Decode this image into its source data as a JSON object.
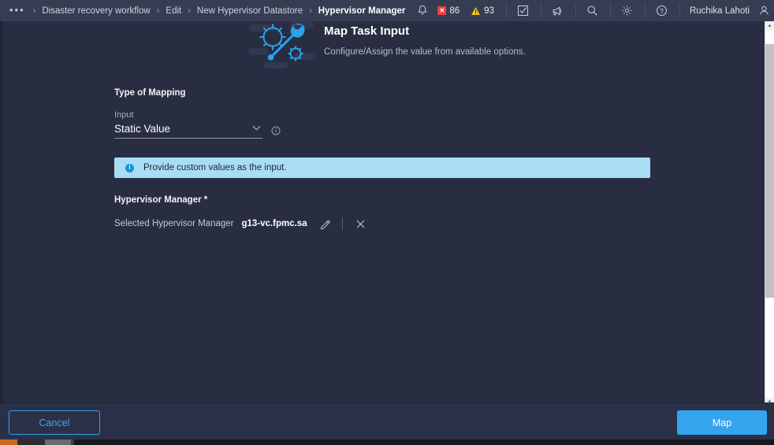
{
  "topbar": {
    "breadcrumb_overflow": "•••",
    "breadcrumb_separator": "›",
    "breadcrumb": [
      {
        "label": "Disaster recovery workflow",
        "current": false
      },
      {
        "label": "Edit",
        "current": false
      },
      {
        "label": "New Hypervisor Datastore",
        "current": false
      },
      {
        "label": "Hypervisor Manager",
        "current": true
      }
    ],
    "notifications": {
      "bell_icon": "bell-icon",
      "error_badge_glyph": "✕",
      "error_count": "86",
      "warning_count": "93"
    },
    "icons": [
      {
        "name": "tasks-icon",
        "label": "Tasks"
      },
      {
        "name": "announcements-icon",
        "label": "Announcements"
      },
      {
        "name": "search-icon",
        "label": "Search"
      },
      {
        "name": "settings-gear-icon",
        "label": "Settings"
      },
      {
        "name": "help-icon",
        "label": "Help"
      }
    ],
    "user": {
      "name": "Ruchika Lahoti",
      "avatar_icon": "user-avatar-icon"
    }
  },
  "dialog": {
    "illustration_icon": "gear-wrench-illustration",
    "title": "Map Task Input",
    "subtitle": "Configure/Assign the value from available options."
  },
  "form": {
    "section_title": "Type of Mapping",
    "input_label": "Input",
    "input_value": "Static Value",
    "input_options": [
      "Static Value"
    ],
    "dropdown_chevron": "⌄",
    "info_icon": "info-circle-icon",
    "banner": {
      "icon": "info-icon",
      "icon_glyph": "i",
      "text": "Provide custom values as the input.",
      "background_color": "#a8ddf5"
    },
    "required_field": {
      "title": "Hypervisor Manager *",
      "selected_label": "Selected Hypervisor Manager",
      "selected_value": "g13-vc.fpmc.sa",
      "edit_icon": "pencil-edit-icon",
      "clear_icon": "close-x-icon"
    }
  },
  "footer": {
    "cancel_label": "Cancel",
    "submit_label": "Map",
    "accent_color": "#35a4ef"
  },
  "scrollbar": {
    "up_arrow": "▲",
    "down_arrow": "▼"
  }
}
